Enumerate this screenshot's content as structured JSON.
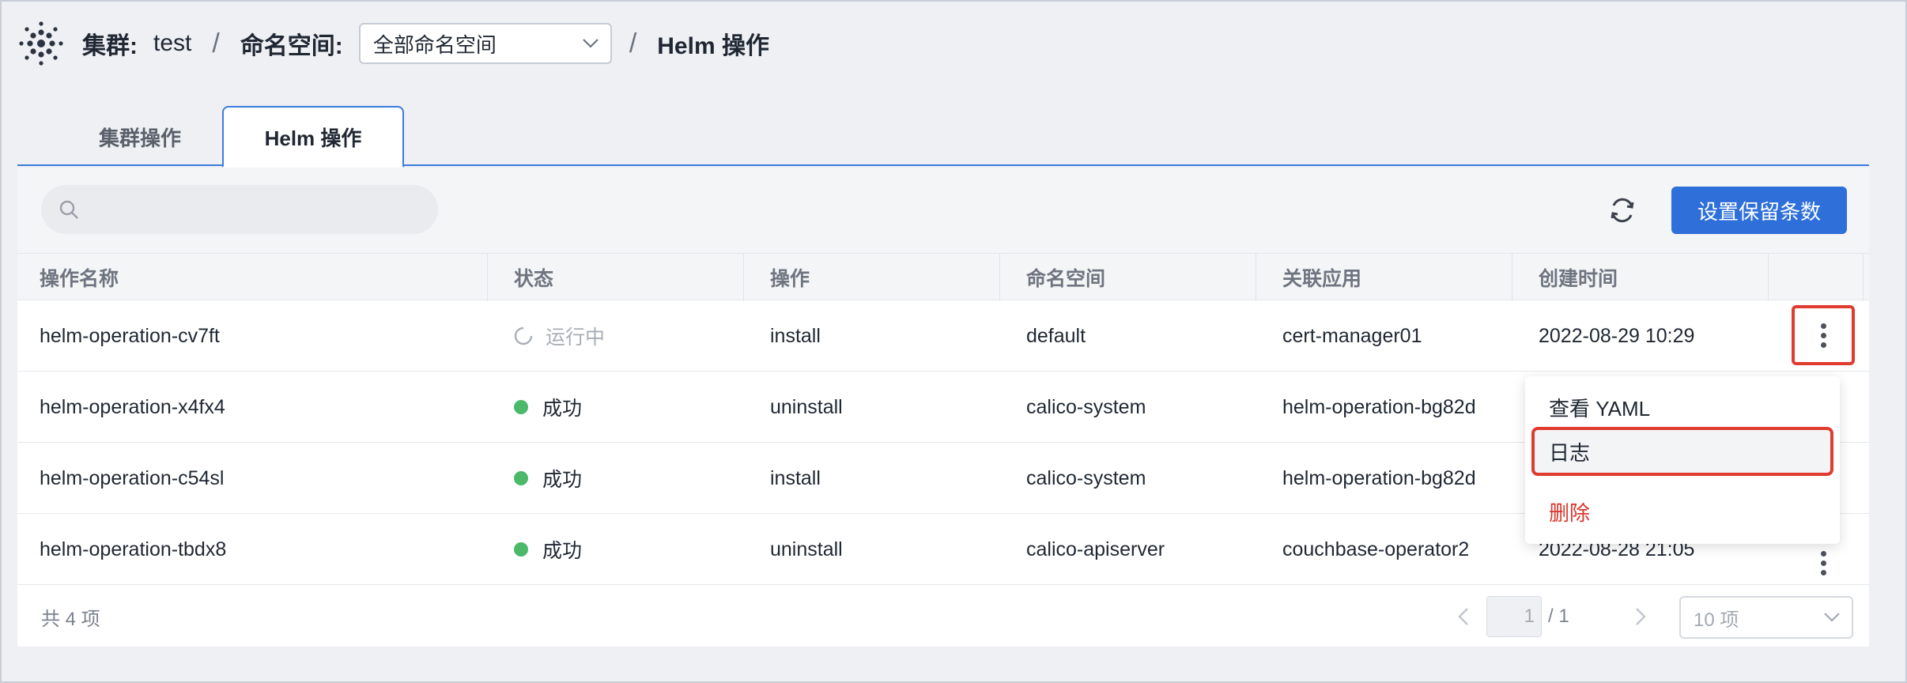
{
  "header": {
    "cluster_label": "集群:",
    "cluster_value": "test",
    "separator": "/",
    "namespace_label": "命名空间:",
    "namespace_selected": "全部命名空间",
    "current_page": "Helm 操作"
  },
  "tabs": [
    {
      "label": "集群操作"
    },
    {
      "label": "Helm 操作"
    }
  ],
  "toolbar": {
    "search_placeholder": "",
    "primary_button": "设置保留条数"
  },
  "table": {
    "columns": [
      "操作名称",
      "状态",
      "操作",
      "命名空间",
      "关联应用",
      "创建时间"
    ],
    "rows": [
      {
        "name": "helm-operation-cv7ft",
        "status": "运行中",
        "status_kind": "running",
        "action": "install",
        "namespace": "default",
        "app": "cert-manager01",
        "created": "2022-08-29 10:29"
      },
      {
        "name": "helm-operation-x4fx4",
        "status": "成功",
        "status_kind": "success",
        "action": "uninstall",
        "namespace": "calico-system",
        "app": "helm-operation-bg82d",
        "created": ""
      },
      {
        "name": "helm-operation-c54sl",
        "status": "成功",
        "status_kind": "success",
        "action": "install",
        "namespace": "calico-system",
        "app": "helm-operation-bg82d",
        "created": ""
      },
      {
        "name": "helm-operation-tbdx8",
        "status": "成功",
        "status_kind": "success",
        "action": "uninstall",
        "namespace": "calico-apiserver",
        "app": "couchbase-operator2",
        "created": "2022-08-28 21:05"
      }
    ]
  },
  "footer": {
    "total": "共 4 项",
    "page_current": "1",
    "page_total": "/ 1",
    "page_size": "10 项"
  },
  "menu": {
    "items": [
      {
        "label": "查看 YAML"
      },
      {
        "label": "日志"
      },
      {
        "label": "删除"
      }
    ]
  },
  "colors": {
    "accent": "#2e6fd9",
    "success": "#4bb86a",
    "danger": "#d9342b",
    "highlight_border": "#e03b2f"
  }
}
